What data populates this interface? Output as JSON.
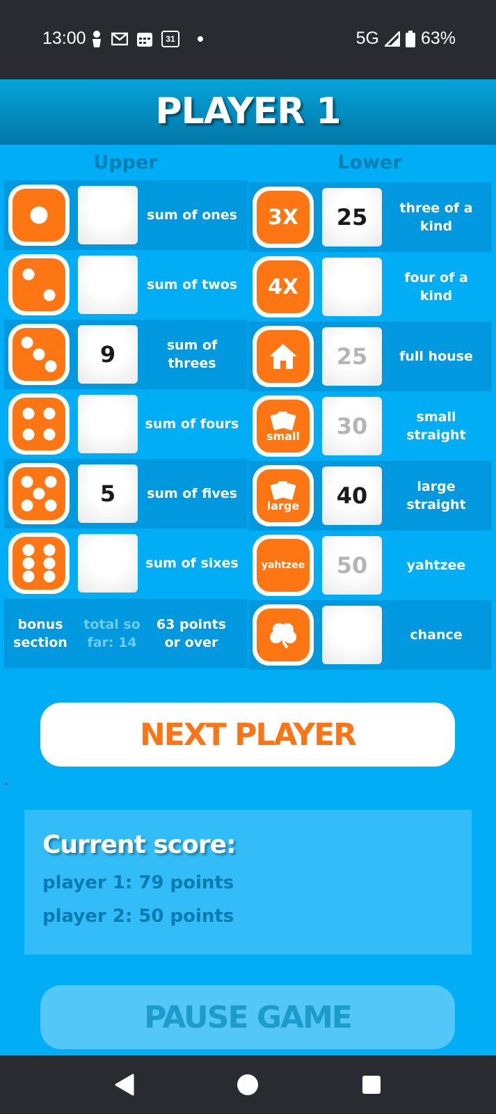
{
  "status_bar": {
    "time": "13:00",
    "icons": [
      "person-icon",
      "gmail-icon",
      "calendar-icon",
      "calendar-31-icon",
      "dot-icon"
    ],
    "calendar_day": "31",
    "network": "5G",
    "battery": "63%"
  },
  "header": {
    "title": "PLAYER 1"
  },
  "upper": {
    "heading": "Upper",
    "rows": [
      {
        "icon": "die-one-icon",
        "value": "",
        "label": "sum of ones"
      },
      {
        "icon": "die-two-icon",
        "value": "",
        "label": "sum of twos"
      },
      {
        "icon": "die-three-icon",
        "value": "9",
        "label": "sum of threes"
      },
      {
        "icon": "die-four-icon",
        "value": "",
        "label": "sum of fours"
      },
      {
        "icon": "die-five-icon",
        "value": "5",
        "label": "sum of fives"
      },
      {
        "icon": "die-six-icon",
        "value": "",
        "label": "sum of sixes"
      }
    ],
    "bonus": {
      "label": "bonus section",
      "total": "total so far: 14",
      "requirement": "63 points or over"
    }
  },
  "lower": {
    "heading": "Lower",
    "rows": [
      {
        "icon": "three-x-icon",
        "icon_text": "3X",
        "value": "25",
        "state": "scored",
        "label": "three of a kind"
      },
      {
        "icon": "four-x-icon",
        "icon_text": "4X",
        "value": "",
        "state": "empty",
        "label": "four of a kind"
      },
      {
        "icon": "house-icon",
        "value": "25",
        "state": "potential",
        "label": "full house"
      },
      {
        "icon": "small-cards-icon",
        "icon_text": "small",
        "value": "30",
        "state": "potential",
        "label": "small straight"
      },
      {
        "icon": "large-cards-icon",
        "icon_text": "large",
        "value": "40",
        "state": "scored",
        "label": "large straight"
      },
      {
        "icon": "yahtzee-icon",
        "icon_text": "yahtzee",
        "value": "50",
        "state": "potential",
        "label": "yahtzee"
      },
      {
        "icon": "clover-icon",
        "value": "",
        "state": "empty",
        "label": "chance"
      }
    ]
  },
  "next_button": "NEXT PLAYER",
  "score": {
    "title": "Current score:",
    "lines": [
      "player 1: 79 points",
      "player 2: 50 points"
    ]
  },
  "pause_button": "PAUSE GAME",
  "colors": {
    "background": "#01aef6",
    "row_dark": "#0098de",
    "accent_orange": "#fd7613",
    "header_dark": "#0277a5"
  }
}
